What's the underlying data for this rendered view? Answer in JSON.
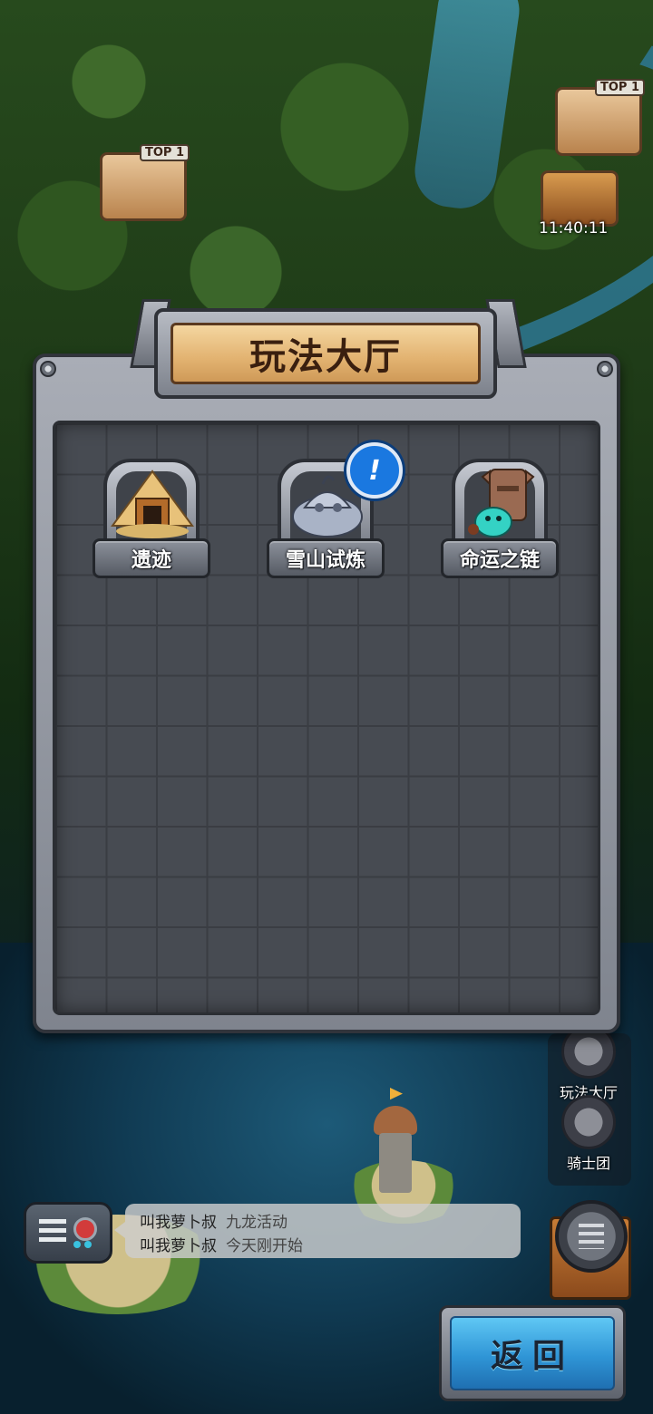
{
  "map": {
    "badges": [
      {
        "tag": "TOP 1"
      },
      {
        "tag": "TOP 1"
      }
    ],
    "timer": "11:40:11",
    "side_buttons": [
      {
        "label": "玩法大厅"
      },
      {
        "label": "骑士团"
      }
    ]
  },
  "panel": {
    "title": "玩法大厅",
    "modes": [
      {
        "label": "遗迹",
        "icon": "ruins-pyramid-icon",
        "notify": false
      },
      {
        "label": "雪山试炼",
        "icon": "snow-statue-icon",
        "notify": true
      },
      {
        "label": "命运之链",
        "icon": "totem-fish-icon",
        "notify": false
      }
    ],
    "notify_glyph": "!"
  },
  "chat": {
    "messages": [
      {
        "name": "叫我萝卜叔",
        "text": "九龙活动"
      },
      {
        "name": "叫我萝卜叔",
        "text": "今天刚开始"
      }
    ]
  },
  "return_button": {
    "label": "返回"
  },
  "colors": {
    "title_scroll": "#e2b270",
    "return_blue": "#2f95d6",
    "notify_blue": "#1a78e0",
    "stone_grey": "#474b52"
  }
}
